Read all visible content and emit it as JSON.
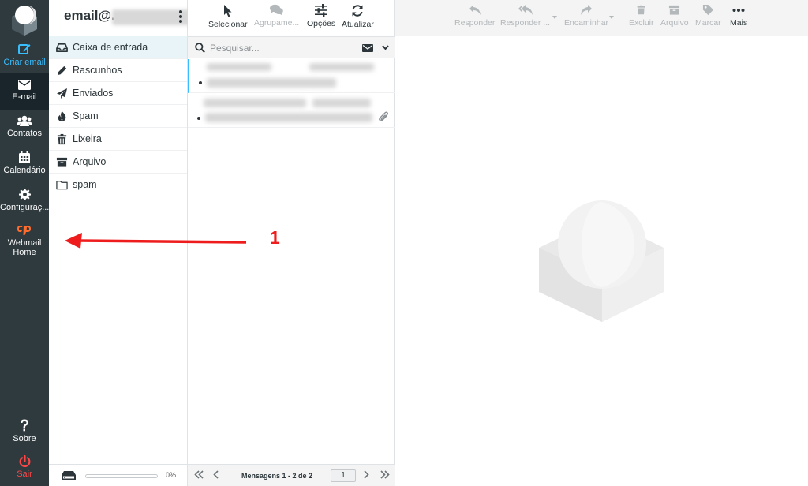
{
  "rail": {
    "compose": "Criar email",
    "mail": "E-mail",
    "contacts": "Contatos",
    "calendar": "Calendário",
    "settings": "Configuraç...",
    "webmail_home_line1": "Webmail",
    "webmail_home_line2": "Home",
    "about": "Sobre",
    "logout": "Sair"
  },
  "folders": {
    "account": "email@...",
    "items": [
      {
        "label": "Caixa de entrada",
        "icon": "inbox-icon"
      },
      {
        "label": "Rascunhos",
        "icon": "pencil-icon"
      },
      {
        "label": "Enviados",
        "icon": "paper-plane-icon"
      },
      {
        "label": "Spam",
        "icon": "flame-icon"
      },
      {
        "label": "Lixeira",
        "icon": "trash-icon"
      },
      {
        "label": "Arquivo",
        "icon": "archive-icon"
      },
      {
        "label": "spam",
        "icon": "folder-icon"
      }
    ],
    "quota_percent": "0%"
  },
  "list_toolbar": {
    "select": "Selecionar",
    "threads": "Agrupame...",
    "options": "Opções",
    "refresh": "Atualizar"
  },
  "search": {
    "placeholder": "Pesquisar..."
  },
  "list_footer": {
    "count": "Mensagens 1 - 2 de 2",
    "page": "1"
  },
  "message_toolbar": {
    "reply": "Responder",
    "reply_all": "Responder ...",
    "forward": "Encaminhar",
    "delete": "Excluir",
    "archive": "Arquivo",
    "mark": "Marcar",
    "more": "Mais"
  },
  "annotation": {
    "number": "1",
    "color": "#ee1c1c"
  },
  "colors": {
    "rail_bg": "#2f3a3f",
    "accent": "#37beff",
    "logout": "#ff4646",
    "selected_folder": "#e9f4f9"
  }
}
